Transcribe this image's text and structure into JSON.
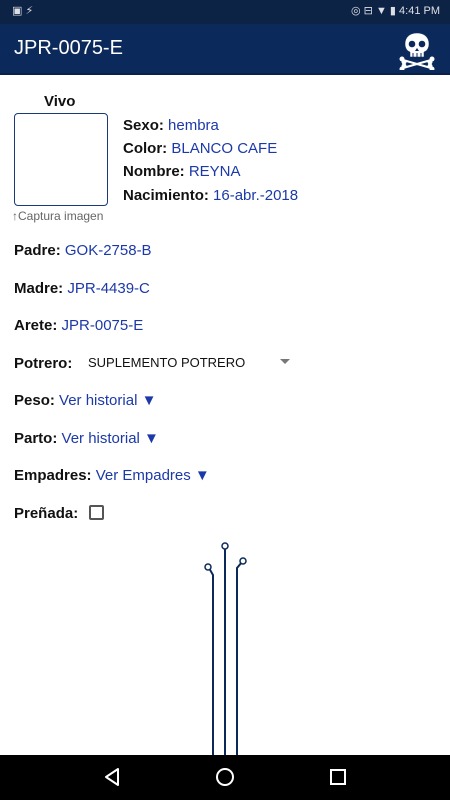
{
  "status_bar": {
    "left_icons": "▣ ⚡",
    "right_icons": "◎ ⊟ ▼ ▮",
    "time": "4:41 PM"
  },
  "app_bar": {
    "title": "JPR-0075-E",
    "action_icon": "skull-crossbones-icon"
  },
  "animal": {
    "status": "Vivo",
    "photo_caption": "↑Captura imagen",
    "sexo": {
      "label": "Sexo:",
      "value": "hembra"
    },
    "color": {
      "label": "Color:",
      "value": "BLANCO CAFE"
    },
    "nombre": {
      "label": "Nombre:",
      "value": "REYNA"
    },
    "nacimiento": {
      "label": "Nacimiento:",
      "value": "16-abr.-2018"
    }
  },
  "details": {
    "padre": {
      "label": "Padre:",
      "value": "GOK-2758-B"
    },
    "madre": {
      "label": "Madre:",
      "value": "JPR-4439-C"
    },
    "arete": {
      "label": "Arete:",
      "value": "JPR-0075-E"
    },
    "potrero": {
      "label": "Potrero:",
      "value": "SUPLEMENTO POTRERO"
    },
    "peso": {
      "label": "Peso:",
      "link": "Ver historial ▼"
    },
    "parto": {
      "label": "Parto:",
      "link": "Ver historial ▼"
    },
    "empadres": {
      "label": "Empadres:",
      "link": "Ver Empadres ▼"
    },
    "prenada": {
      "label": "Preñada:",
      "checked": false
    }
  },
  "nav": {
    "back": "back-icon",
    "home": "home-icon",
    "recents": "recents-icon"
  },
  "colors": {
    "app_bar": "#0b2a5b",
    "status_bar": "#0d2345",
    "link": "#1c39a8"
  }
}
